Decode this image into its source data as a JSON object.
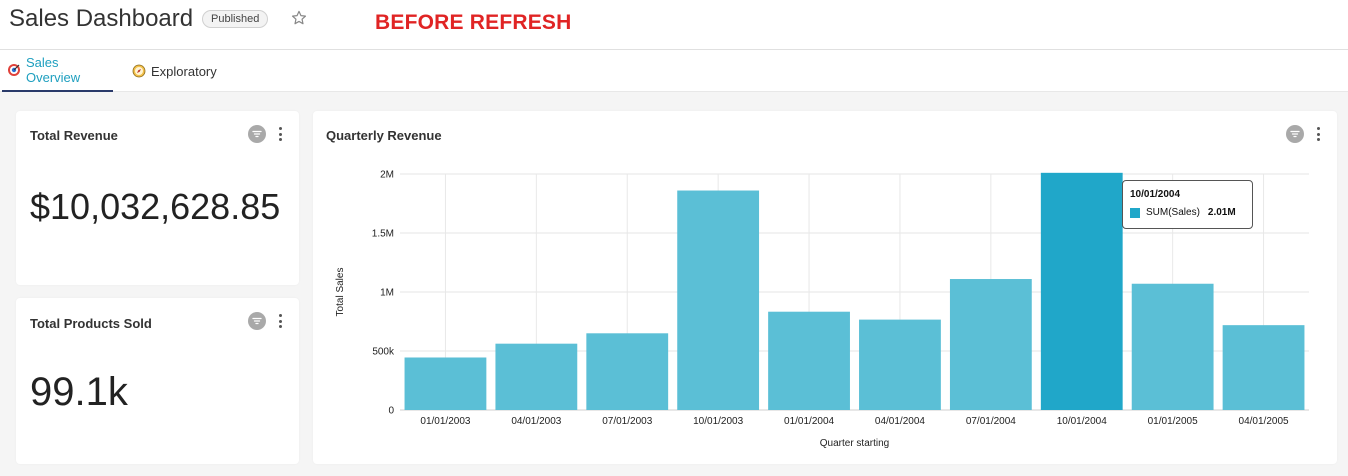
{
  "header": {
    "title": "Sales Dashboard",
    "status_badge": "Published",
    "annotation": "BEFORE REFRESH"
  },
  "tabs": [
    {
      "label": "Sales Overview",
      "active": true
    },
    {
      "label": "Exploratory",
      "active": false
    }
  ],
  "cards": {
    "total_revenue": {
      "title": "Total Revenue",
      "value": "$10,032,628.85"
    },
    "total_products": {
      "title": "Total Products Sold",
      "value": "99.1k"
    }
  },
  "chart": {
    "title": "Quarterly Revenue"
  },
  "chart_data": {
    "type": "bar",
    "title": "Quarterly Revenue",
    "xlabel": "Quarter starting",
    "ylabel": "Total Sales",
    "categories": [
      "01/01/2003",
      "04/01/2003",
      "07/01/2003",
      "10/01/2003",
      "01/01/2004",
      "04/01/2004",
      "07/01/2004",
      "10/01/2004",
      "01/01/2005",
      "04/01/2005"
    ],
    "series": [
      {
        "name": "SUM(Sales)",
        "values": [
          445000,
          562000,
          650000,
          1860000,
          833000,
          766000,
          1110000,
          2010000,
          1070000,
          719000
        ]
      }
    ],
    "ylim": [
      0,
      2000000
    ],
    "yticks": [
      0,
      500000,
      1000000,
      1500000,
      2000000
    ],
    "ytick_labels": [
      "0",
      "500k",
      "1M",
      "1.5M",
      "2M"
    ],
    "grid": true,
    "highlighted_index": 7,
    "bar_color": "#5bbfd6",
    "highlight_color": "#20a7c9",
    "tooltip": {
      "date": "10/01/2004",
      "series": "SUM(Sales)",
      "value": "2.01M"
    }
  }
}
